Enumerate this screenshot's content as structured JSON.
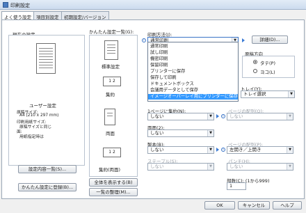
{
  "window": {
    "title": "印刷設定"
  },
  "tabs": [
    "よく使う設定",
    "項目別設定",
    "初期設定/バージョン"
  ],
  "left": {
    "group_title": "現在の設定",
    "summary_title": "ユーザー設定",
    "summary_lines": [
      "原稿サイズ:",
      "A4 (210 x 297 mm)",
      "印刷用紙サイズ:",
      "原稿サイズと同じ",
      "面:",
      "用紙指定時は"
    ],
    "show_button": "設定内容一覧(S)...",
    "register_button": "かんたん設定に登録(B)..."
  },
  "presets": {
    "title": "かんたん設定一覧(G):",
    "items": [
      "標準設定",
      "集約",
      "両面",
      "集約(両面)"
    ],
    "show_all_button": "全体を表示する(B)",
    "organize_button": "一覧の整理(M)..."
  },
  "print_method": {
    "label": "印刷方法(J):",
    "value": "通常印刷",
    "details_button": "詳細(D)...",
    "options": [
      "通常印刷",
      "試し印刷",
      "機密印刷",
      "保留印刷",
      "プリンターに保存",
      "保存して印刷",
      "ドキュメントボックス",
      "会議用データとして保存",
      "イメージオーバーレイ用にプリンターに保存"
    ]
  },
  "orientation": {
    "label": "原稿方向",
    "options": [
      "タテ(P)",
      "ヨコ(L)"
    ]
  },
  "tray": {
    "label": "トレイ(Y):",
    "value": "トレイ選択"
  },
  "nup": {
    "label": "1ページに集約(N):",
    "value": "しない",
    "order_label": "ページの配列(O):",
    "order_value": "しない"
  },
  "duplex": {
    "label": "両面(2):",
    "value": "しない"
  },
  "staple": {
    "label": "製本(B):",
    "value": "しない",
    "page_order_label": "ページの配列(P):",
    "page_order_value": "左開き／上開き"
  },
  "staple2": {
    "label": "ステープル(S):",
    "value": "しない",
    "punch_label": "パンチ(H):",
    "punch_value": "しない"
  },
  "copies": {
    "label": "部数(C): (1から999)",
    "value": "1"
  },
  "footer": {
    "ok": "OK",
    "cancel": "キャンセル",
    "help": "ヘルプ"
  }
}
